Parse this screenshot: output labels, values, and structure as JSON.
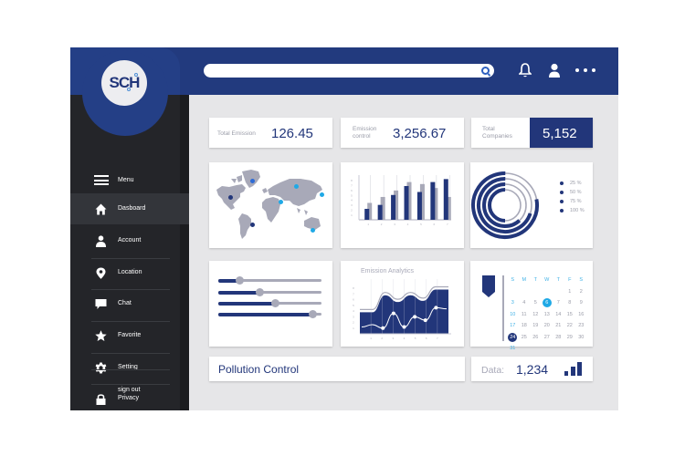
{
  "brand": {
    "logo_text": "SCH"
  },
  "colors": {
    "primary": "#223a7e",
    "sidebar": "#242529",
    "accent": "#1fa9e6",
    "muted": "#a8a9b8",
    "background": "#e6e6e8"
  },
  "header": {
    "search": {
      "value": "",
      "placeholder": ""
    },
    "icons": [
      "search-icon",
      "bell-icon",
      "user-icon",
      "more-icon"
    ]
  },
  "sidebar": {
    "menu_label": "Menu",
    "items": [
      {
        "label": "Dasboard",
        "icon": "home-icon",
        "active": true
      },
      {
        "label": "Account",
        "icon": "user-icon",
        "active": false
      },
      {
        "label": "Location",
        "icon": "location-pin-icon",
        "active": false
      },
      {
        "label": "Chat",
        "icon": "chat-icon",
        "active": false
      },
      {
        "label": "Favorite",
        "icon": "star-icon",
        "active": false
      },
      {
        "label": "Setting",
        "icon": "gear-icon",
        "active": false
      },
      {
        "label": "Privacy",
        "icon": "lock-icon",
        "active": false
      }
    ],
    "sign_out": "sign out"
  },
  "stats": [
    {
      "label_line1": "Total Emission",
      "label_line2": "",
      "value": "126.45"
    },
    {
      "label_line1": "Emission",
      "label_line2": "control",
      "value": "3,256.67"
    },
    {
      "label_line1": "Total",
      "label_line2": "Companies",
      "value": "5,152"
    }
  ],
  "map": {
    "markers": [
      "North America",
      "Greenland",
      "South America",
      "Europe",
      "North Russia",
      "East Russia",
      "Australia"
    ]
  },
  "sliders": {
    "values": [
      0.2,
      0.4,
      0.55,
      0.91
    ]
  },
  "rings": {
    "legend": [
      "25 %",
      "50 %",
      "75 %",
      "100 %"
    ]
  },
  "emission_analytics": {
    "title": "Emission Analytics"
  },
  "calendar": {
    "weekdays": [
      "S",
      "M",
      "T",
      "W",
      "T",
      "F",
      "S"
    ],
    "leading_blanks": 2,
    "days": 31,
    "highlighted_day": 6,
    "marked_day": 24
  },
  "footer": {
    "pollution_title": "Pollution Control",
    "data_label": "Data:",
    "data_value": "1,234"
  },
  "chart_data": [
    {
      "type": "bar",
      "title": "",
      "categories": [
        "1",
        "2",
        "3",
        "4",
        "5",
        "6",
        "7"
      ],
      "series": [
        {
          "name": "primary",
          "color": "#22367a",
          "values": [
            2.2,
            3.0,
            5.0,
            6.8,
            5.6,
            7.6,
            8.2
          ]
        },
        {
          "name": "secondary",
          "color": "#a8a9b8",
          "values": [
            3.4,
            4.6,
            5.9,
            7.6,
            7.2,
            6.4,
            4.6
          ]
        }
      ],
      "xlabel": "",
      "ylabel": "",
      "yticks": [
        "1",
        "2",
        "3",
        "4",
        "5",
        "6",
        "7",
        "8"
      ],
      "ylim": [
        0,
        9
      ],
      "grid": false
    },
    {
      "type": "pie",
      "title": "",
      "subtype": "radial-rings",
      "labels": [
        "25 %",
        "50 %",
        "75 %",
        "100 %"
      ],
      "values": [
        0.5,
        0.62,
        0.7,
        0.78
      ]
    },
    {
      "type": "area",
      "title": "Emission Analytics",
      "x": [
        1,
        2,
        3,
        4,
        5,
        6,
        7
      ],
      "series": [
        {
          "name": "area",
          "color": "#22367a",
          "values": [
            3.8,
            3.8,
            6.8,
            5.6,
            6.8,
            5.8,
            7.8,
            7.8
          ]
        },
        {
          "name": "line",
          "color": "#ffffff",
          "values": [
            1.2,
            1.6,
            1.0,
            3.6,
            1.2,
            3.0,
            2.4,
            4.6,
            4.4
          ]
        }
      ],
      "xticks": [
        "1",
        "2",
        "3",
        "4",
        "5",
        "6",
        "7"
      ],
      "yticks": [
        "1",
        "2",
        "3",
        "4",
        "5",
        "6",
        "7",
        "8"
      ],
      "ylim": [
        0,
        9
      ],
      "grid": true
    }
  ]
}
